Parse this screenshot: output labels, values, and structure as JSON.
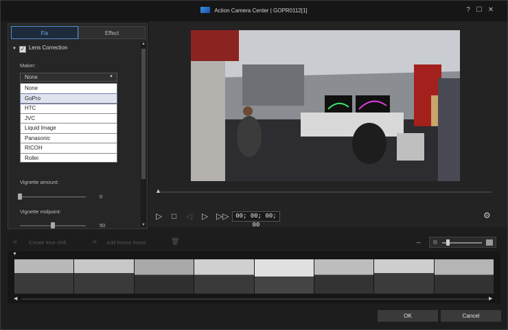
{
  "window": {
    "title": "Action Camera Center | GOPR0112[1]",
    "help": "?",
    "maximize": "☐",
    "close": "✕"
  },
  "tabs": [
    {
      "label": "Fix",
      "active": true
    },
    {
      "label": "Effect",
      "active": false
    }
  ],
  "lens_correction": {
    "label": "Lens Correction",
    "checked": true,
    "maker_label": "Maker:",
    "maker_value": "None",
    "options": [
      "None",
      "GoPro",
      "HTC",
      "JVC",
      "Liquid Image",
      "Panasonic",
      "RICOH",
      "Rollei"
    ],
    "highlighted": "GoPro"
  },
  "vignette": {
    "amount_label": "Vignette amount:",
    "amount_value": "0",
    "amount_fraction": 0.0,
    "midpoint_label": "Vignette midpoint:",
    "midpoint_value": "50",
    "midpoint_fraction": 0.5
  },
  "playback": {
    "timecode": "00; 00; 00; 00"
  },
  "timeline_toolbar": {
    "create_time_shift": "Create time shift",
    "add_freeze_frame": "Add freeze frame"
  },
  "footer": {
    "ok": "OK",
    "cancel": "Cancel"
  },
  "colors": {
    "accent": "#4f8fd6",
    "dropdown_highlight": "#dfe3ee"
  }
}
